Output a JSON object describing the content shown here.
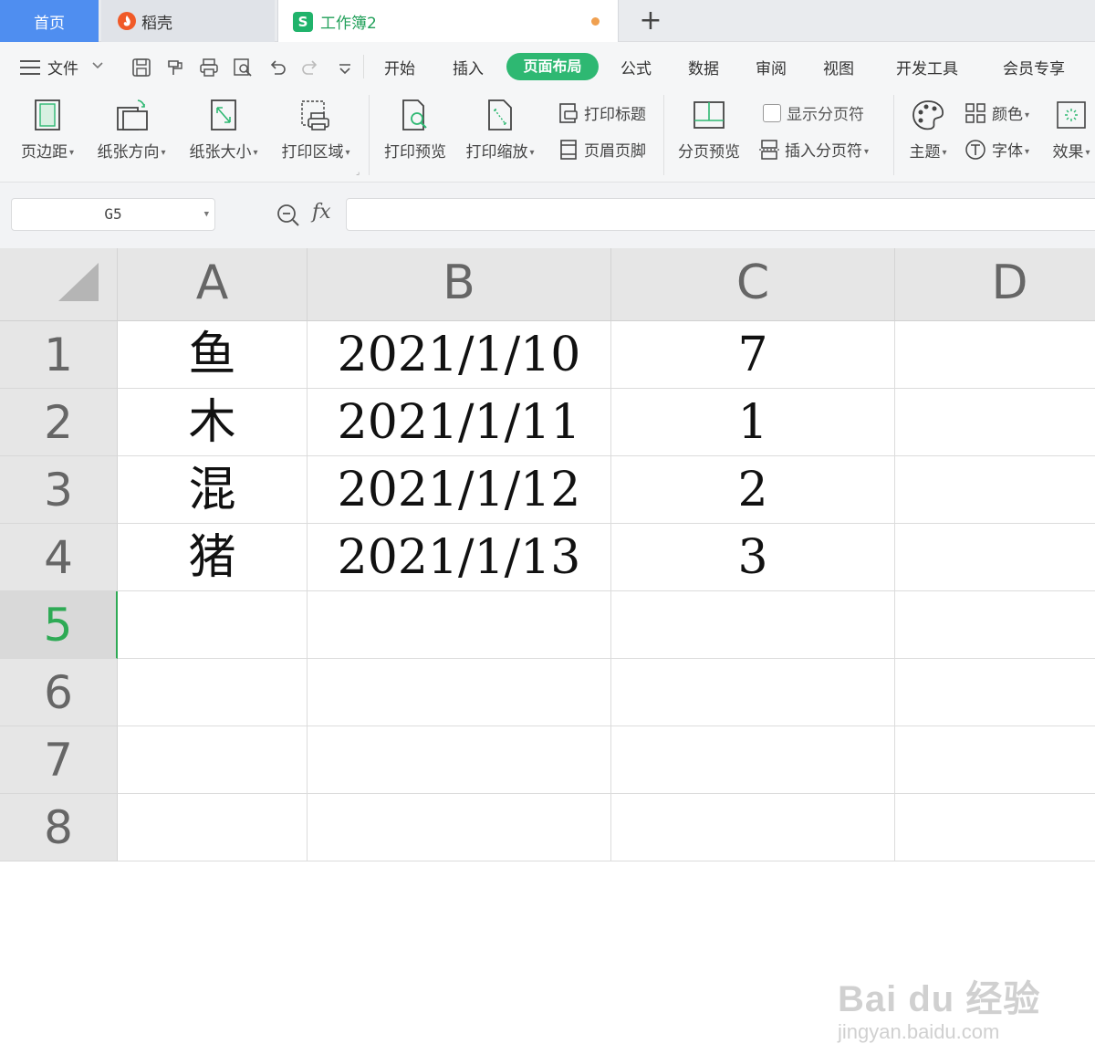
{
  "tabs": {
    "home": "首页",
    "daoke": "稻壳",
    "workbook": "工作簿2",
    "new_tab": "+"
  },
  "menu": {
    "file": "文件",
    "items": [
      "开始",
      "插入",
      "页面布局",
      "公式",
      "数据",
      "审阅",
      "视图",
      "开发工具",
      "会员专享"
    ],
    "active": "页面布局"
  },
  "ribbon": {
    "margins": "页边距",
    "orientation": "纸张方向",
    "size": "纸张大小",
    "print_area": "打印区域",
    "print_preview": "打印预览",
    "print_scale": "打印缩放",
    "print_titles": "打印标题",
    "header_footer": "页眉页脚",
    "page_break_preview": "分页预览",
    "show_page_breaks": "显示分页符",
    "insert_page_break": "插入分页符",
    "theme": "主题",
    "colors": "颜色",
    "fonts": "字体",
    "effects": "效果"
  },
  "formula_bar": {
    "name_box": "G5",
    "fx": "fx",
    "formula": ""
  },
  "grid": {
    "columns": [
      "A",
      "B",
      "C",
      "D"
    ],
    "rows": [
      "1",
      "2",
      "3",
      "4",
      "5",
      "6",
      "7",
      "8"
    ],
    "active_row": "5",
    "cells": [
      [
        "鱼",
        "2021/1/10",
        "7",
        ""
      ],
      [
        "木",
        "2021/1/11",
        "1",
        ""
      ],
      [
        "混",
        "2021/1/12",
        "2",
        ""
      ],
      [
        "猪",
        "2021/1/13",
        "3",
        ""
      ],
      [
        "",
        "",
        "",
        ""
      ],
      [
        "",
        "",
        "",
        ""
      ],
      [
        "",
        "",
        "",
        ""
      ],
      [
        "",
        "",
        "",
        ""
      ]
    ]
  },
  "watermark": {
    "main": "Bai du 经验",
    "sub": "jingyan.baidu.com"
  },
  "colors": {
    "accent_green": "#2eb872",
    "tab_blue": "#4f8ef0"
  }
}
